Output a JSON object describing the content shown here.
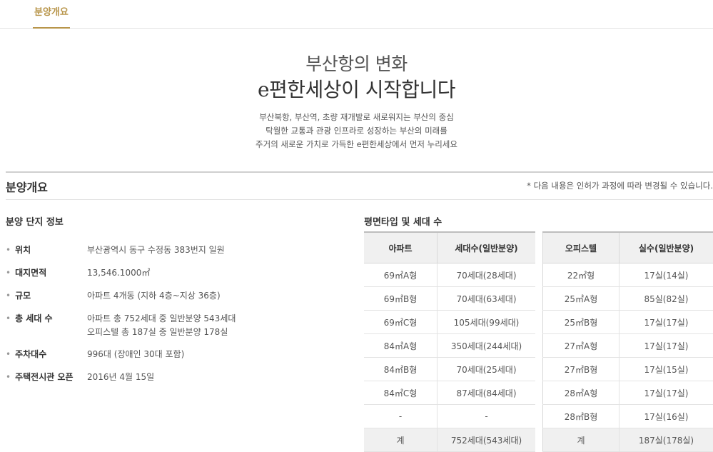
{
  "tab": {
    "label": "분양개요"
  },
  "hero": {
    "title1": "부산항의 변화",
    "title2": "e편한세상이 시작합니다",
    "desc": [
      "부산북항, 부산역, 초량 재개발로 새로워지는 부산의 중심",
      "탁월한 교통과 관광 인프라로 성장하는 부산의 미래를",
      "주거의 새로운 가치로 가득한 e편한세상에서 먼저 누리세요"
    ]
  },
  "section": {
    "title": "분양개요",
    "note": "* 다음 내용은 인허가 과정에 따라 변경될 수 있습니다."
  },
  "complex": {
    "title": "분양 단지 정보",
    "rows": [
      {
        "label": "위치",
        "value": [
          "부산광역시 동구 수정동 383번지 일원"
        ]
      },
      {
        "label": "대지면적",
        "value": [
          "13,546.1000㎡"
        ]
      },
      {
        "label": "규모",
        "value": [
          "아파트 4개동 (지하 4층~지상 36층)"
        ]
      },
      {
        "label": "총 세대 수",
        "value": [
          "아파트 총 752세대 중 일반분양 543세대",
          "오피스텔 총 187실 중 일반분양 178실"
        ]
      },
      {
        "label": "주차대수",
        "value": [
          "996대 (장애인 30대 포함)"
        ]
      },
      {
        "label": "주택전시관 오픈",
        "value": [
          "2016년 4월 15일"
        ]
      }
    ]
  },
  "units": {
    "title": "평면타입 및 세대 수",
    "apt": {
      "headers": [
        "아파트",
        "세대수(일반분양)"
      ],
      "rows": [
        [
          "69㎡A형",
          "70세대(28세대)"
        ],
        [
          "69㎡B형",
          "70세대(63세대)"
        ],
        [
          "69㎡C형",
          "105세대(99세대)"
        ],
        [
          "84㎡A형",
          "350세대(244세대)"
        ],
        [
          "84㎡B형",
          "70세대(25세대)"
        ],
        [
          "84㎡C형",
          "87세대(84세대)"
        ],
        [
          "-",
          "-"
        ]
      ],
      "total": [
        "계",
        "752세대(543세대)"
      ]
    },
    "officetel": {
      "headers": [
        "오피스텔",
        "실수(일반분양)"
      ],
      "rows": [
        [
          "22㎡형",
          "17실(14실)"
        ],
        [
          "25㎡A형",
          "85실(82실)"
        ],
        [
          "25㎡B형",
          "17실(17실)"
        ],
        [
          "27㎡A형",
          "17실(17실)"
        ],
        [
          "27㎡B형",
          "17실(15실)"
        ],
        [
          "28㎡A형",
          "17실(17실)"
        ],
        [
          "28㎡B형",
          "17실(16실)"
        ]
      ],
      "total": [
        "계",
        "187실(178실)"
      ]
    }
  }
}
